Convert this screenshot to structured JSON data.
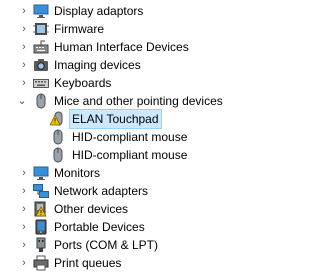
{
  "device_manager": {
    "categories": [
      {
        "label": "Display adaptors",
        "expanded": false,
        "icon": "display-adapter-icon"
      },
      {
        "label": "Firmware",
        "expanded": false,
        "icon": "firmware-icon"
      },
      {
        "label": "Human Interface Devices",
        "expanded": false,
        "icon": "hid-icon"
      },
      {
        "label": "Imaging devices",
        "expanded": false,
        "icon": "camera-icon"
      },
      {
        "label": "Keyboards",
        "expanded": false,
        "icon": "keyboard-icon"
      },
      {
        "label": "Mice and other pointing devices",
        "expanded": true,
        "icon": "mouse-icon",
        "children": [
          {
            "label": "ELAN Touchpad",
            "icon": "warning-icon",
            "selected": true
          },
          {
            "label": "HID-compliant mouse",
            "icon": "mouse-icon"
          },
          {
            "label": "HID-compliant mouse",
            "icon": "mouse-icon"
          }
        ]
      },
      {
        "label": "Monitors",
        "expanded": false,
        "icon": "monitor-icon"
      },
      {
        "label": "Network adapters",
        "expanded": false,
        "icon": "network-icon"
      },
      {
        "label": "Other devices",
        "expanded": false,
        "icon": "other-devices-icon"
      },
      {
        "label": "Portable Devices",
        "expanded": false,
        "icon": "portable-device-icon"
      },
      {
        "label": "Ports (COM & LPT)",
        "expanded": false,
        "icon": "port-icon"
      },
      {
        "label": "Print queues",
        "expanded": false,
        "icon": "printer-icon"
      }
    ]
  },
  "colors": {
    "selection_bg": "#cce8ff",
    "selection_border": "#99d1ff",
    "warning": "#f2c200"
  }
}
